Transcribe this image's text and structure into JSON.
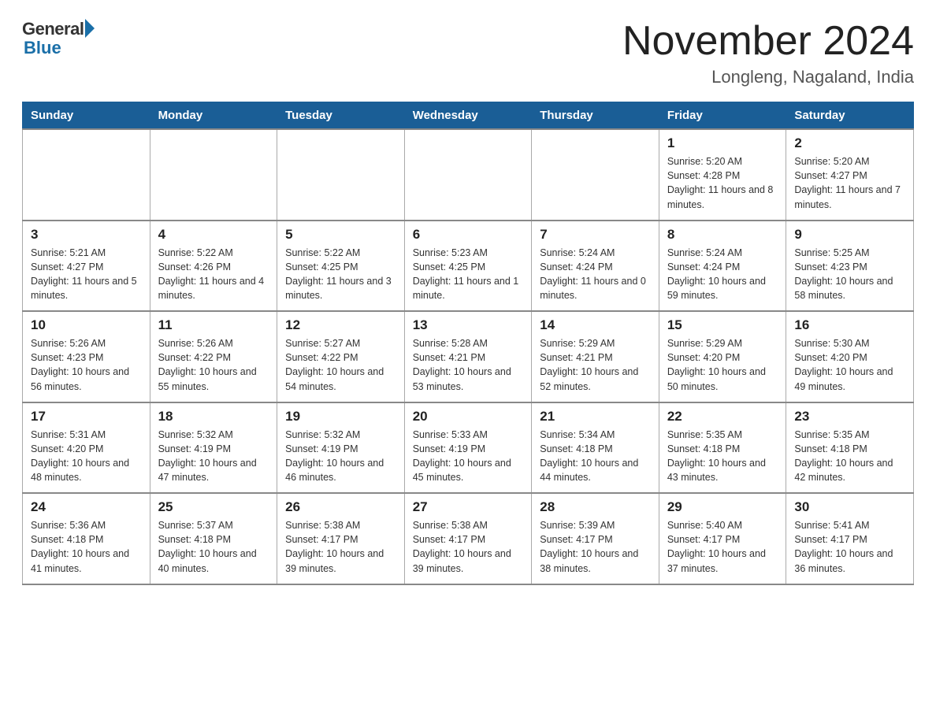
{
  "header": {
    "logo_general": "General",
    "logo_blue": "Blue",
    "month_title": "November 2024",
    "location": "Longleng, Nagaland, India"
  },
  "weekdays": [
    "Sunday",
    "Monday",
    "Tuesday",
    "Wednesday",
    "Thursday",
    "Friday",
    "Saturday"
  ],
  "weeks": [
    [
      {
        "day": "",
        "info": ""
      },
      {
        "day": "",
        "info": ""
      },
      {
        "day": "",
        "info": ""
      },
      {
        "day": "",
        "info": ""
      },
      {
        "day": "",
        "info": ""
      },
      {
        "day": "1",
        "info": "Sunrise: 5:20 AM\nSunset: 4:28 PM\nDaylight: 11 hours and 8 minutes."
      },
      {
        "day": "2",
        "info": "Sunrise: 5:20 AM\nSunset: 4:27 PM\nDaylight: 11 hours and 7 minutes."
      }
    ],
    [
      {
        "day": "3",
        "info": "Sunrise: 5:21 AM\nSunset: 4:27 PM\nDaylight: 11 hours and 5 minutes."
      },
      {
        "day": "4",
        "info": "Sunrise: 5:22 AM\nSunset: 4:26 PM\nDaylight: 11 hours and 4 minutes."
      },
      {
        "day": "5",
        "info": "Sunrise: 5:22 AM\nSunset: 4:25 PM\nDaylight: 11 hours and 3 minutes."
      },
      {
        "day": "6",
        "info": "Sunrise: 5:23 AM\nSunset: 4:25 PM\nDaylight: 11 hours and 1 minute."
      },
      {
        "day": "7",
        "info": "Sunrise: 5:24 AM\nSunset: 4:24 PM\nDaylight: 11 hours and 0 minutes."
      },
      {
        "day": "8",
        "info": "Sunrise: 5:24 AM\nSunset: 4:24 PM\nDaylight: 10 hours and 59 minutes."
      },
      {
        "day": "9",
        "info": "Sunrise: 5:25 AM\nSunset: 4:23 PM\nDaylight: 10 hours and 58 minutes."
      }
    ],
    [
      {
        "day": "10",
        "info": "Sunrise: 5:26 AM\nSunset: 4:23 PM\nDaylight: 10 hours and 56 minutes."
      },
      {
        "day": "11",
        "info": "Sunrise: 5:26 AM\nSunset: 4:22 PM\nDaylight: 10 hours and 55 minutes."
      },
      {
        "day": "12",
        "info": "Sunrise: 5:27 AM\nSunset: 4:22 PM\nDaylight: 10 hours and 54 minutes."
      },
      {
        "day": "13",
        "info": "Sunrise: 5:28 AM\nSunset: 4:21 PM\nDaylight: 10 hours and 53 minutes."
      },
      {
        "day": "14",
        "info": "Sunrise: 5:29 AM\nSunset: 4:21 PM\nDaylight: 10 hours and 52 minutes."
      },
      {
        "day": "15",
        "info": "Sunrise: 5:29 AM\nSunset: 4:20 PM\nDaylight: 10 hours and 50 minutes."
      },
      {
        "day": "16",
        "info": "Sunrise: 5:30 AM\nSunset: 4:20 PM\nDaylight: 10 hours and 49 minutes."
      }
    ],
    [
      {
        "day": "17",
        "info": "Sunrise: 5:31 AM\nSunset: 4:20 PM\nDaylight: 10 hours and 48 minutes."
      },
      {
        "day": "18",
        "info": "Sunrise: 5:32 AM\nSunset: 4:19 PM\nDaylight: 10 hours and 47 minutes."
      },
      {
        "day": "19",
        "info": "Sunrise: 5:32 AM\nSunset: 4:19 PM\nDaylight: 10 hours and 46 minutes."
      },
      {
        "day": "20",
        "info": "Sunrise: 5:33 AM\nSunset: 4:19 PM\nDaylight: 10 hours and 45 minutes."
      },
      {
        "day": "21",
        "info": "Sunrise: 5:34 AM\nSunset: 4:18 PM\nDaylight: 10 hours and 44 minutes."
      },
      {
        "day": "22",
        "info": "Sunrise: 5:35 AM\nSunset: 4:18 PM\nDaylight: 10 hours and 43 minutes."
      },
      {
        "day": "23",
        "info": "Sunrise: 5:35 AM\nSunset: 4:18 PM\nDaylight: 10 hours and 42 minutes."
      }
    ],
    [
      {
        "day": "24",
        "info": "Sunrise: 5:36 AM\nSunset: 4:18 PM\nDaylight: 10 hours and 41 minutes."
      },
      {
        "day": "25",
        "info": "Sunrise: 5:37 AM\nSunset: 4:18 PM\nDaylight: 10 hours and 40 minutes."
      },
      {
        "day": "26",
        "info": "Sunrise: 5:38 AM\nSunset: 4:17 PM\nDaylight: 10 hours and 39 minutes."
      },
      {
        "day": "27",
        "info": "Sunrise: 5:38 AM\nSunset: 4:17 PM\nDaylight: 10 hours and 39 minutes."
      },
      {
        "day": "28",
        "info": "Sunrise: 5:39 AM\nSunset: 4:17 PM\nDaylight: 10 hours and 38 minutes."
      },
      {
        "day": "29",
        "info": "Sunrise: 5:40 AM\nSunset: 4:17 PM\nDaylight: 10 hours and 37 minutes."
      },
      {
        "day": "30",
        "info": "Sunrise: 5:41 AM\nSunset: 4:17 PM\nDaylight: 10 hours and 36 minutes."
      }
    ]
  ]
}
